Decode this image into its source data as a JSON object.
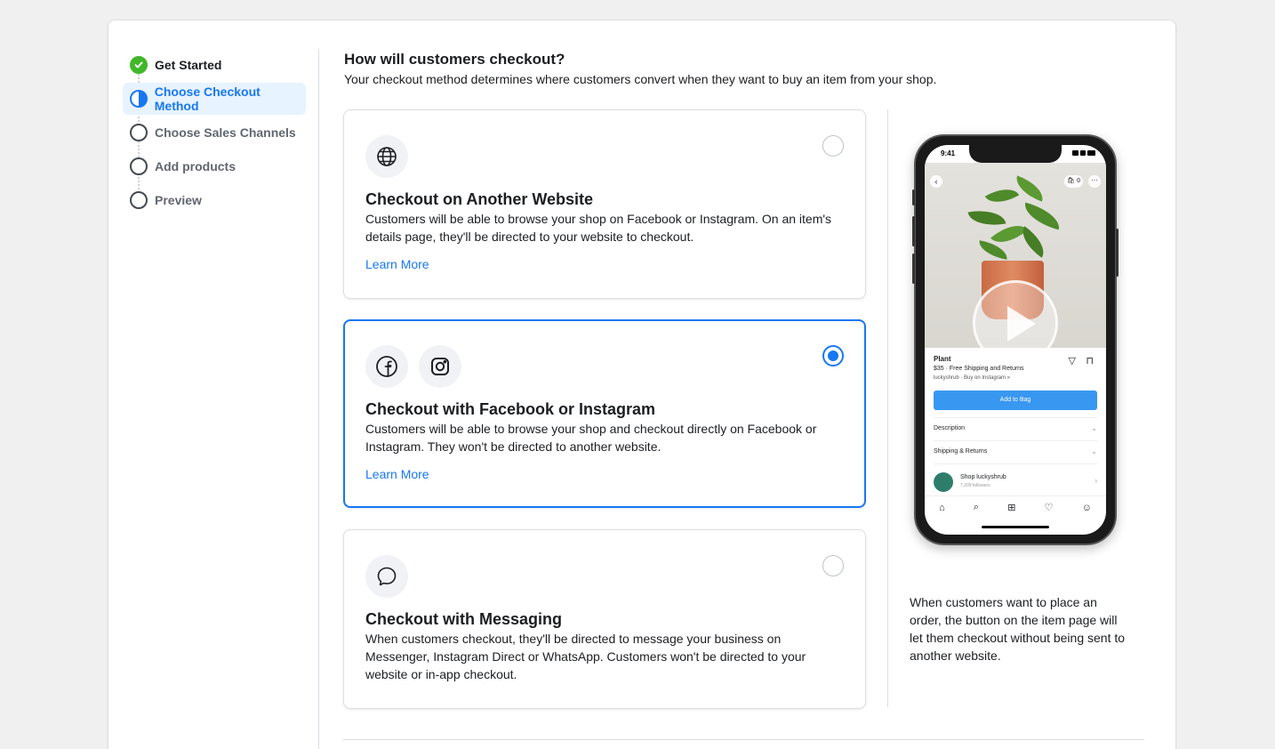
{
  "steps": [
    {
      "label": "Get Started",
      "status": "done"
    },
    {
      "label": "Choose Checkout Method",
      "status": "active"
    },
    {
      "label": "Choose Sales Channels",
      "status": "todo"
    },
    {
      "label": "Add products",
      "status": "todo"
    },
    {
      "label": "Preview",
      "status": "todo"
    }
  ],
  "main": {
    "heading": "How will customers checkout?",
    "subheading": "Your checkout method determines where customers convert when they want to buy an item from your shop."
  },
  "options": [
    {
      "title": "Checkout on Another Website",
      "description": "Customers will be able to browse your shop on Facebook or Instagram. On an item's details page, they'll be directed to your website to checkout.",
      "link": "Learn More",
      "selected": false,
      "icons": [
        "globe-icon"
      ]
    },
    {
      "title": "Checkout with Facebook or Instagram",
      "description": "Customers will be able to browse your shop and checkout directly on Facebook or Instagram. They won't be directed to another website.",
      "link": "Learn More",
      "selected": true,
      "icons": [
        "facebook-icon",
        "instagram-icon"
      ]
    },
    {
      "title": "Checkout with Messaging",
      "description": "When customers checkout, they'll be directed to message your business on Messenger, Instagram Direct or WhatsApp. Customers won't be directed to your website or in-app checkout.",
      "selected": false,
      "icons": [
        "messenger-bubble-icon"
      ]
    }
  ],
  "preview": {
    "time": "9:41",
    "cart_count": "0",
    "product_name": "Plant",
    "price_line": "$35 · Free Shipping and Returns",
    "shop_line": "luckyshrub · Buy on Instagram »",
    "add_button": "Add to Bag",
    "rows": [
      "Description",
      "Shipping & Returns"
    ],
    "shop_name": "Shop luckyshrub",
    "followers": "7,209 followers",
    "side_description": "When customers want to place an order, the button on the item page will let them checkout without being sent to another website."
  },
  "colors": {
    "accent": "#1877f2",
    "success": "#42b72a",
    "active_bg": "#e7f3ff"
  }
}
